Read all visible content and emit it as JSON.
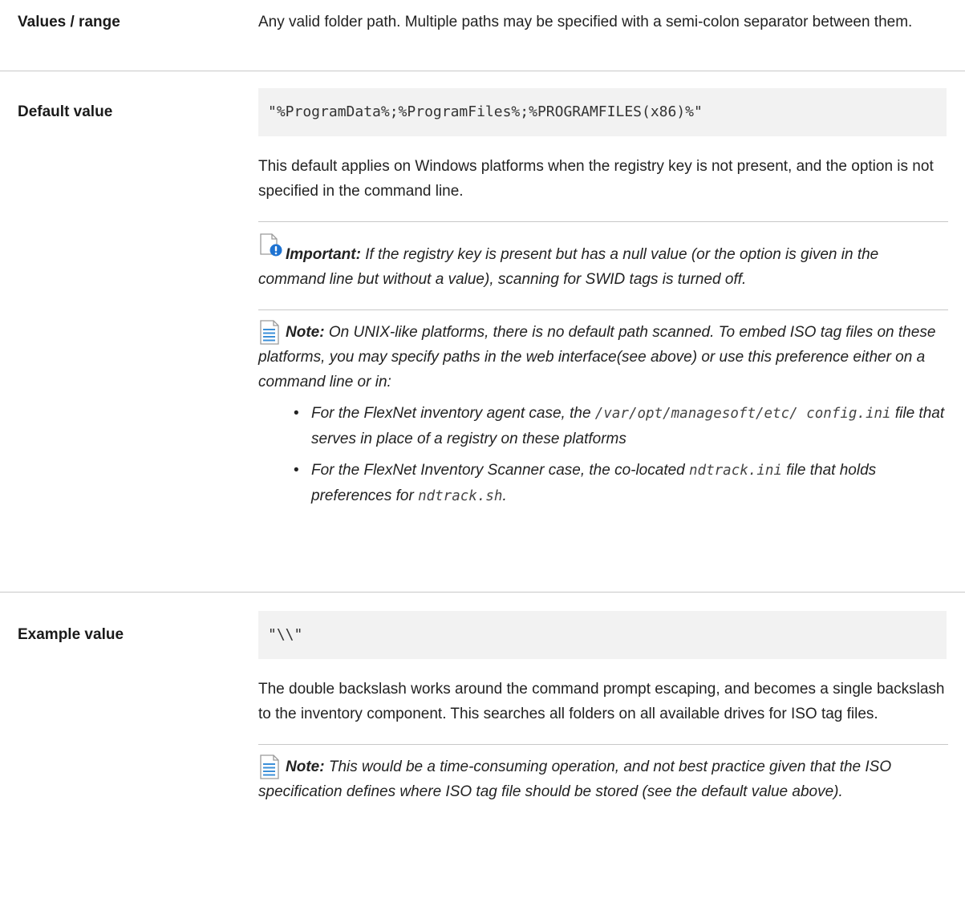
{
  "values_range": {
    "label": "Values / range",
    "text": "Any valid folder path. Multiple paths may be specified with a semi-colon separator between them."
  },
  "default_value": {
    "label": "Default value",
    "code": "\"%ProgramData%;%ProgramFiles%;%PROGRAMFILES(x86)%\"",
    "text": "This default applies on Windows platforms when the registry key is not present, and the option is not specified in the command line.",
    "important": {
      "label": "Important:",
      "text": "If the registry key is present but has a null value (or the option is given in the command line but without a value), scanning for SWID tags is turned off."
    },
    "note": {
      "label": "Note:",
      "text": "On UNIX-like platforms, there is no default path scanned. To embed ISO tag files on these platforms, you may specify paths in the web interface(see above) or use this preference either on a command line or in:",
      "bullets": [
        {
          "pre": "For the FlexNet inventory agent case, the",
          "code": "/var/opt/managesoft/etc/ config.ini",
          "post": "file that serves in place of a registry on these platforms"
        },
        {
          "pre": "For the FlexNet Inventory Scanner case, the co-located",
          "code": "ndtrack.ini",
          "mid": "file that holds preferences for",
          "code2": "ndtrack.sh",
          "post": "."
        }
      ]
    }
  },
  "example_value": {
    "label": "Example value",
    "code": "\"\\\\\"",
    "text": "The double backslash works around the command prompt escaping, and becomes a single backslash to the inventory component. This searches all folders on all available drives for ISO tag files.",
    "note": {
      "label": "Note:",
      "text": "This would be a time-consuming operation, and not best practice given that the ISO specification defines where ISO tag file should be stored (see the default value above)."
    }
  },
  "icons": {
    "important": "document-important-icon",
    "note": "document-note-icon"
  },
  "colors": {
    "rule": "#c8c8c8",
    "code_bg": "#f2f2f2",
    "important_blue": "#1e73d2"
  }
}
